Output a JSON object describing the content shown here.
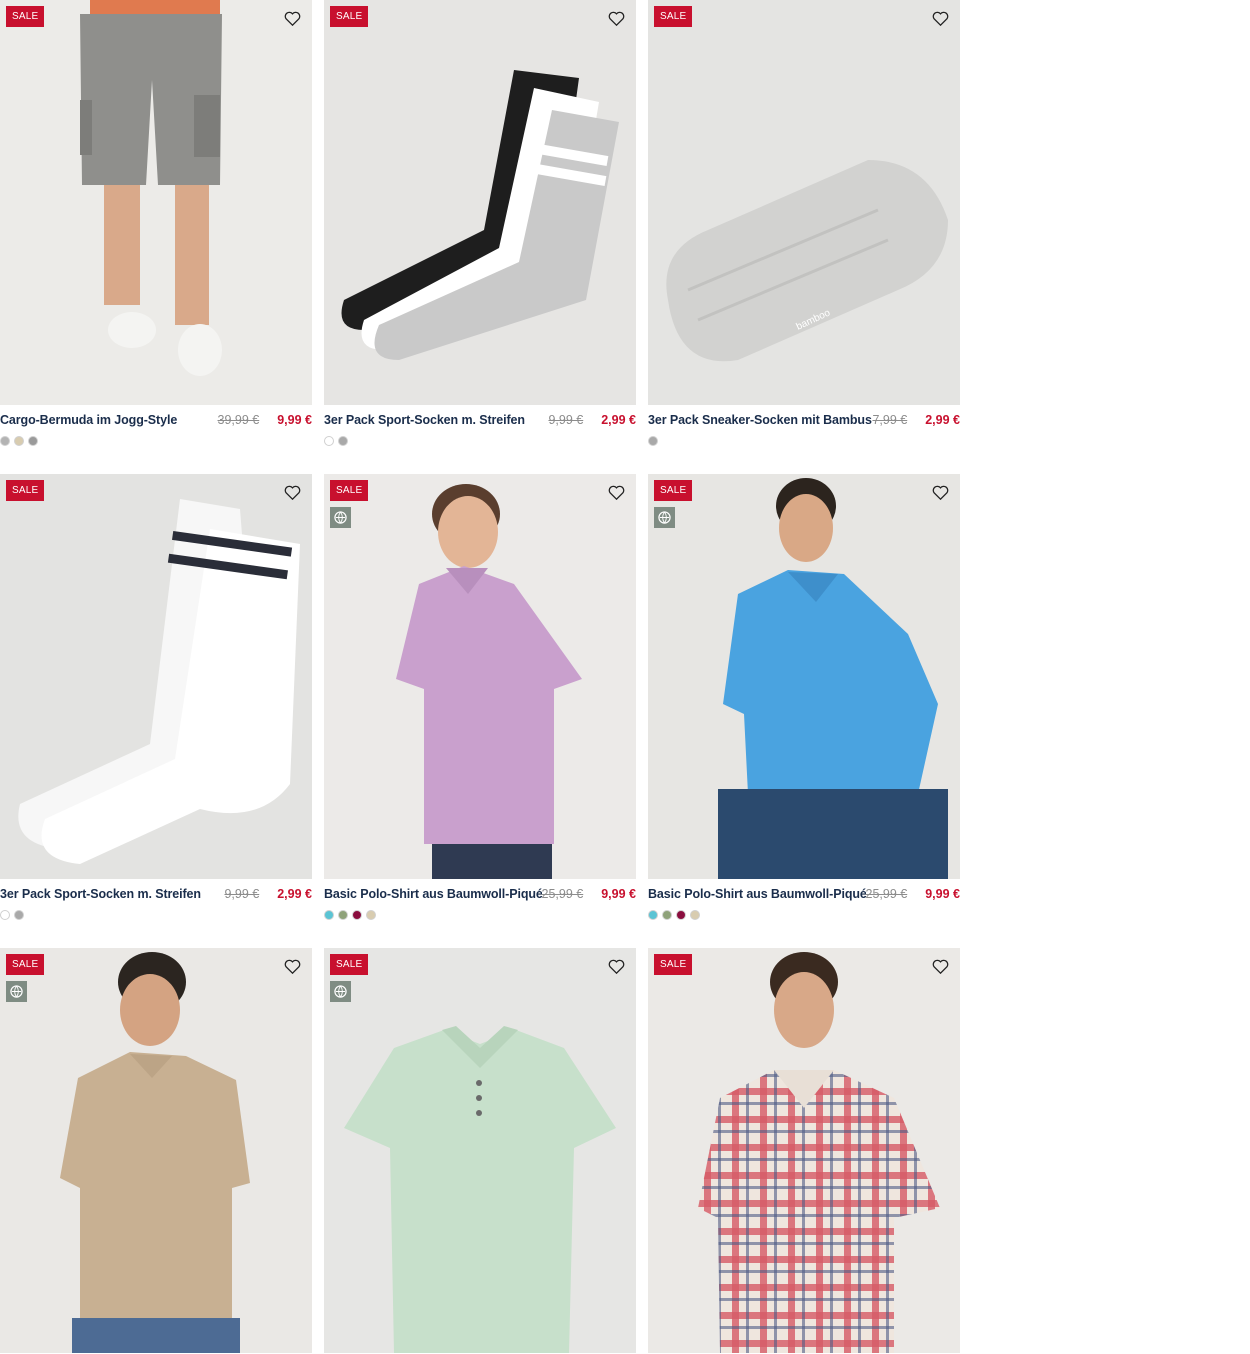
{
  "products": [
    {
      "name": "Cargo-Bermuda im Jogg-Style",
      "badge": "SALE",
      "eco": false,
      "old_price": "39,99 €",
      "price": "9,99 €",
      "swatches": [
        "#b3b3b3",
        "#d8ccb0",
        "#9a9a9a"
      ]
    },
    {
      "name": "3er Pack Sport-Socken m. Streifen",
      "badge": "SALE",
      "eco": false,
      "old_price": "9,99 €",
      "price": "2,99 €",
      "swatches": [
        "#ffffff",
        "#a9a9a9"
      ]
    },
    {
      "name": "3er Pack Sneaker-Socken mit Bambus",
      "badge": "SALE",
      "eco": false,
      "old_price": "7,99 €",
      "price": "2,99 €",
      "swatches": [
        "#a9a9a9"
      ]
    },
    {
      "name": "3er Pack Sport-Socken m. Streifen",
      "badge": "SALE",
      "eco": false,
      "old_price": "9,99 €",
      "price": "2,99 €",
      "swatches": [
        "#ffffff",
        "#a9a9a9"
      ]
    },
    {
      "name": "Basic Polo-Shirt aus Baumwoll-Piqué",
      "badge": "SALE",
      "eco": true,
      "old_price": "25,99 €",
      "price": "9,99 €",
      "swatches": [
        "#5bc4d4",
        "#8fa27a",
        "#8a0d3e",
        "#d8ccb0"
      ]
    },
    {
      "name": "Basic Polo-Shirt aus Baumwoll-Piqué",
      "badge": "SALE",
      "eco": true,
      "old_price": "25,99 €",
      "price": "9,99 €",
      "swatches": [
        "#5bc4d4",
        "#8fa27a",
        "#8a0d3e",
        "#d8ccb0"
      ]
    },
    {
      "name": "",
      "badge": "SALE",
      "eco": true,
      "old_price": "",
      "price": "",
      "swatches": []
    },
    {
      "name": "",
      "badge": "SALE",
      "eco": true,
      "old_price": "",
      "price": "",
      "swatches": []
    },
    {
      "name": "",
      "badge": "SALE",
      "eco": false,
      "old_price": "",
      "price": "",
      "swatches": []
    }
  ],
  "icons": {
    "wishlist": "heart-outline-icon",
    "eco": "globe-icon"
  },
  "colors": {
    "sale": "#c8102e",
    "text": "#1a2d4b",
    "eco": "#7f8c83"
  }
}
